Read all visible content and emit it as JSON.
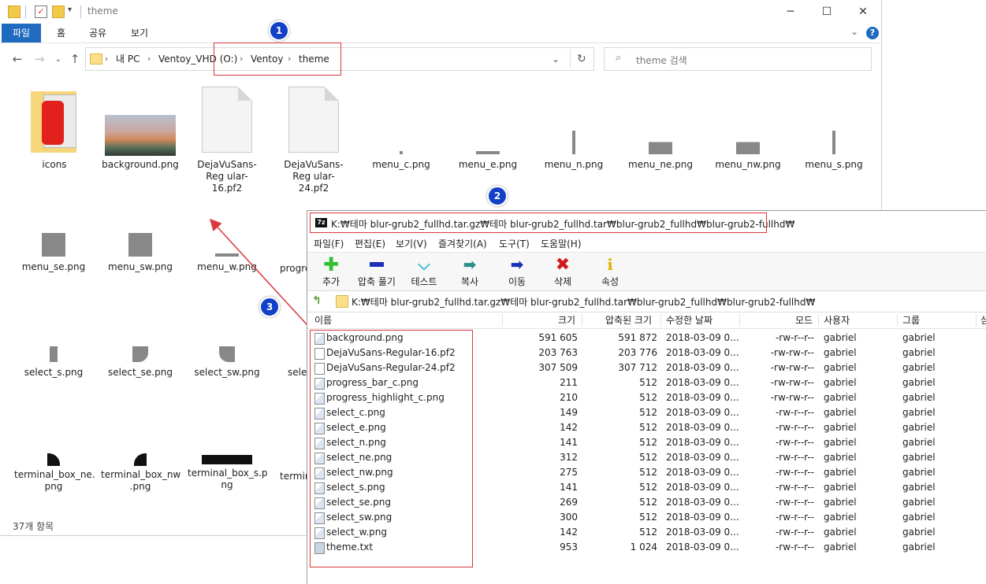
{
  "explorer": {
    "title": "theme",
    "ribbon_tabs": [
      "파일",
      "홈",
      "공유",
      "보기"
    ],
    "breadcrumb": [
      "내 PC",
      "Ventoy_VHD (O:)",
      "Ventoy",
      "theme"
    ],
    "search_placeholder": "theme 검색",
    "status": "37개 항목",
    "items": [
      {
        "label": "icons",
        "icon": "folder-icon"
      },
      {
        "label": "background.png",
        "icon": "image-thumbnail"
      },
      {
        "label": "DejaVuSans-Reg ular-16.pf2",
        "icon": "document-icon"
      },
      {
        "label": "DejaVuSans-Reg ular-24.pf2",
        "icon": "document-icon"
      },
      {
        "label": "menu_c.png",
        "icon": "image-thumbnail"
      },
      {
        "label": "menu_e.png",
        "icon": "image-thumbnail"
      },
      {
        "label": "menu_n.png",
        "icon": "image-thumbnail"
      },
      {
        "label": "menu_ne.png",
        "icon": "image-thumbnail"
      },
      {
        "label": "menu_nw.png",
        "icon": "image-thumbnail"
      },
      {
        "label": "menu_s.png",
        "icon": "image-thumbnail"
      },
      {
        "label": "menu_se.png",
        "icon": "image-thumbnail"
      },
      {
        "label": "menu_sw.png",
        "icon": "image-thumbnail"
      },
      {
        "label": "menu_w.png",
        "icon": "image-thumbnail"
      },
      {
        "label": "progre",
        "icon": "image-thumbnail"
      },
      {
        "label": "select_s.png",
        "icon": "image-thumbnail"
      },
      {
        "label": "select_se.png",
        "icon": "image-thumbnail"
      },
      {
        "label": "select_sw.png",
        "icon": "image-thumbnail"
      },
      {
        "label": "selec",
        "icon": "image-thumbnail"
      },
      {
        "label": "terminal_box_ne. png",
        "icon": "image-thumbnail"
      },
      {
        "label": "terminal_box_nw .png",
        "icon": "image-thumbnail"
      },
      {
        "label": "terminal_box_s.p ng",
        "icon": "image-thumbnail"
      },
      {
        "label": "termin",
        "icon": "image-thumbnail"
      }
    ]
  },
  "badges": [
    "1",
    "2",
    "3"
  ],
  "sevenzip": {
    "logo": "7z",
    "title": "K:₩테마 blur-grub2_fullhd.tar.gz₩테마 blur-grub2_fullhd.tar₩blur-grub2_fullhd₩blur-grub2-fullhd₩",
    "menu": [
      "파일(F)",
      "편집(E)",
      "보기(V)",
      "즐겨찾기(A)",
      "도구(T)",
      "도움말(H)"
    ],
    "toolbar": [
      {
        "label": "추가",
        "icon": "plus-icon",
        "color": "#2fbf2f"
      },
      {
        "label": "압축 풀기",
        "icon": "minus-icon",
        "color": "#1a2fb8"
      },
      {
        "label": "테스트",
        "icon": "check-icon",
        "color": "#25b7c8"
      },
      {
        "label": "복사",
        "icon": "copy-arrow-icon",
        "color": "#2a8f86"
      },
      {
        "label": "이동",
        "icon": "move-arrow-icon",
        "color": "#1a2fb8"
      },
      {
        "label": "삭제",
        "icon": "delete-icon",
        "color": "#d21a1a"
      },
      {
        "label": "속성",
        "icon": "info-icon",
        "color": "#d9b300"
      }
    ],
    "path": "K:₩테마 blur-grub2_fullhd.tar.gz₩테마 blur-grub2_fullhd.tar₩blur-grub2_fullhd₩blur-grub2-fullhd₩",
    "columns": [
      "이름",
      "크기",
      "압축된 크기",
      "수정한 날짜",
      "모드",
      "사용자",
      "그룹",
      "심"
    ],
    "rows": [
      {
        "name": "background.png",
        "size": "591 605",
        "packed": "591 872",
        "date": "2018-03-09 0...",
        "mode": "-rw-r--r--",
        "user": "gabriel",
        "group": "gabriel",
        "type": "png"
      },
      {
        "name": "DejaVuSans-Regular-16.pf2",
        "size": "203 763",
        "packed": "203 776",
        "date": "2018-03-09 0...",
        "mode": "-rw-rw-r--",
        "user": "gabriel",
        "group": "gabriel",
        "type": "file"
      },
      {
        "name": "DejaVuSans-Regular-24.pf2",
        "size": "307 509",
        "packed": "307 712",
        "date": "2018-03-09 0...",
        "mode": "-rw-rw-r--",
        "user": "gabriel",
        "group": "gabriel",
        "type": "file"
      },
      {
        "name": "progress_bar_c.png",
        "size": "211",
        "packed": "512",
        "date": "2018-03-09 0...",
        "mode": "-rw-rw-r--",
        "user": "gabriel",
        "group": "gabriel",
        "type": "png"
      },
      {
        "name": "progress_highlight_c.png",
        "size": "210",
        "packed": "512",
        "date": "2018-03-09 0...",
        "mode": "-rw-rw-r--",
        "user": "gabriel",
        "group": "gabriel",
        "type": "png"
      },
      {
        "name": "select_c.png",
        "size": "149",
        "packed": "512",
        "date": "2018-03-09 0...",
        "mode": "-rw-r--r--",
        "user": "gabriel",
        "group": "gabriel",
        "type": "png"
      },
      {
        "name": "select_e.png",
        "size": "142",
        "packed": "512",
        "date": "2018-03-09 0...",
        "mode": "-rw-r--r--",
        "user": "gabriel",
        "group": "gabriel",
        "type": "png"
      },
      {
        "name": "select_n.png",
        "size": "141",
        "packed": "512",
        "date": "2018-03-09 0...",
        "mode": "-rw-r--r--",
        "user": "gabriel",
        "group": "gabriel",
        "type": "png"
      },
      {
        "name": "select_ne.png",
        "size": "312",
        "packed": "512",
        "date": "2018-03-09 0...",
        "mode": "-rw-r--r--",
        "user": "gabriel",
        "group": "gabriel",
        "type": "png"
      },
      {
        "name": "select_nw.png",
        "size": "275",
        "packed": "512",
        "date": "2018-03-09 0...",
        "mode": "-rw-r--r--",
        "user": "gabriel",
        "group": "gabriel",
        "type": "png"
      },
      {
        "name": "select_s.png",
        "size": "141",
        "packed": "512",
        "date": "2018-03-09 0...",
        "mode": "-rw-r--r--",
        "user": "gabriel",
        "group": "gabriel",
        "type": "png"
      },
      {
        "name": "select_se.png",
        "size": "269",
        "packed": "512",
        "date": "2018-03-09 0...",
        "mode": "-rw-r--r--",
        "user": "gabriel",
        "group": "gabriel",
        "type": "png"
      },
      {
        "name": "select_sw.png",
        "size": "300",
        "packed": "512",
        "date": "2018-03-09 0...",
        "mode": "-rw-r--r--",
        "user": "gabriel",
        "group": "gabriel",
        "type": "png"
      },
      {
        "name": "select_w.png",
        "size": "142",
        "packed": "512",
        "date": "2018-03-09 0...",
        "mode": "-rw-r--r--",
        "user": "gabriel",
        "group": "gabriel",
        "type": "png"
      },
      {
        "name": "theme.txt",
        "size": "953",
        "packed": "1 024",
        "date": "2018-03-09 0...",
        "mode": "-rw-r--r--",
        "user": "gabriel",
        "group": "gabriel",
        "type": "txt"
      }
    ]
  }
}
